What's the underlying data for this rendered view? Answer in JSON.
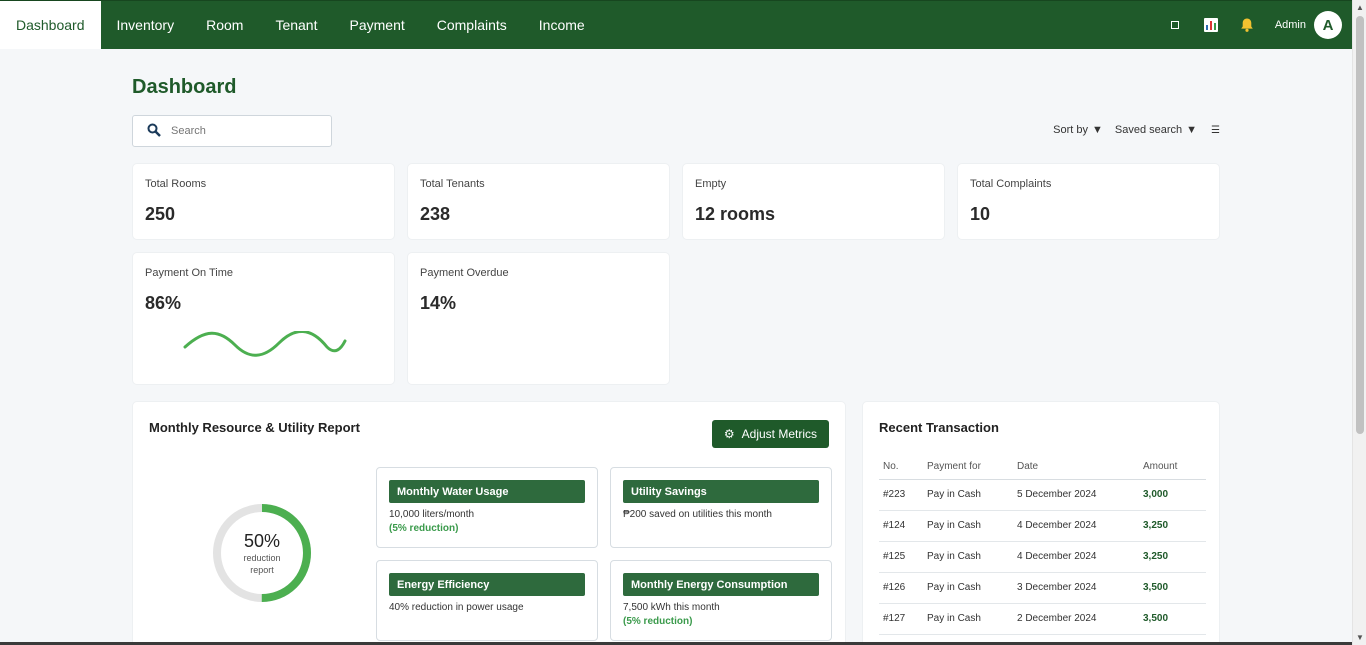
{
  "nav": {
    "tabs": [
      {
        "label": "Dashboard",
        "active": true
      },
      {
        "label": "Inventory"
      },
      {
        "label": "Room"
      },
      {
        "label": "Tenant"
      },
      {
        "label": "Payment"
      },
      {
        "label": "Complaints"
      },
      {
        "label": "Income"
      }
    ],
    "icons": [
      "square-icon",
      "bar-chart-icon",
      "bell-icon"
    ],
    "user_label": "Admin",
    "avatar_initial": "A"
  },
  "page": {
    "title": "Dashboard",
    "search_placeholder": "Search",
    "sort_label": "Sort by",
    "saved_search_label": "Saved search"
  },
  "stats": [
    {
      "label": "Total Rooms",
      "value": "250"
    },
    {
      "label": "Total Tenants",
      "value": "238"
    },
    {
      "label": "Empty",
      "value": "12 rooms"
    },
    {
      "label": "Total Complaints",
      "value": "10"
    },
    {
      "label": "Payment On Time",
      "value": "86%"
    },
    {
      "label": "Payment Overdue",
      "value": "14%"
    }
  ],
  "report": {
    "title": "Monthly Resource & Utility Report",
    "adjust_label": "Adjust Metrics",
    "donut": {
      "percent": 50,
      "label": "50%",
      "sub1": "reduction",
      "sub2": "report"
    },
    "metrics": [
      {
        "title": "Monthly Water Usage",
        "text": "10,000 liters/month",
        "sub": "(5% reduction)"
      },
      {
        "title": "Utility Savings",
        "text": "₱200 saved on utilities this month",
        "sub": ""
      },
      {
        "title": "Energy Efficiency",
        "text": "40% reduction in power usage",
        "sub": ""
      },
      {
        "title": "Monthly Energy Consumption",
        "text": "7,500 kWh this month",
        "sub": "(5% reduction)"
      }
    ]
  },
  "transactions": {
    "title": "Recent Transaction",
    "headers": [
      "No.",
      "Payment for",
      "Date",
      "Amount"
    ],
    "rows": [
      [
        "#223",
        "Pay in Cash",
        "5 December 2024",
        "3,000"
      ],
      [
        "#124",
        "Pay in Cash",
        "4 December 2024",
        "3,250"
      ],
      [
        "#125",
        "Pay in Cash",
        "4 December 2024",
        "3,250"
      ],
      [
        "#126",
        "Pay in Cash",
        "3 December 2024",
        "3,500"
      ],
      [
        "#127",
        "Pay in Cash",
        "2 December 2024",
        "3,500"
      ]
    ]
  },
  "colors": {
    "brand": "#1f5a2a",
    "accent": "#4caf50"
  }
}
